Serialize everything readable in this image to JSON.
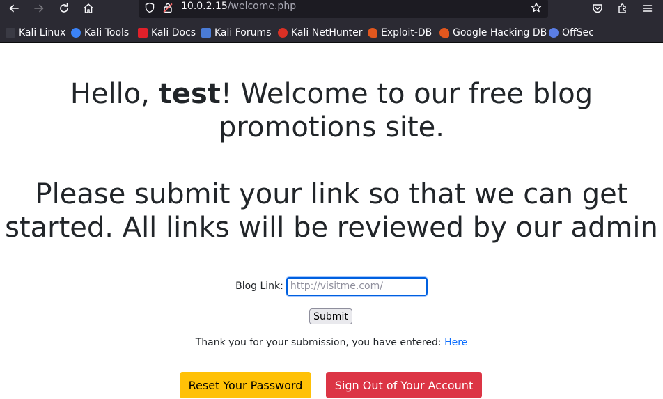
{
  "browser": {
    "url_host": "10.0.2.15",
    "url_path": "/welcome.php",
    "bookmarks": [
      {
        "label": "Kali Linux",
        "icon": "kali-dragon-icon",
        "color": "#4f4f4f"
      },
      {
        "label": "Kali Tools",
        "icon": "kali-tools-icon",
        "color": "#3b82f6"
      },
      {
        "label": "Kali Docs",
        "icon": "kali-docs-icon",
        "color": "#e0202a"
      },
      {
        "label": "Kali Forums",
        "icon": "kali-forums-icon",
        "color": "#4a7bd6"
      },
      {
        "label": "Kali NetHunter",
        "icon": "nethunter-icon",
        "color": "#d93025"
      },
      {
        "label": "Exploit-DB",
        "icon": "exploit-db-icon",
        "color": "#e2571e"
      },
      {
        "label": "Google Hacking DB",
        "icon": "ghdb-icon",
        "color": "#e2571e"
      },
      {
        "label": "OffSec",
        "icon": "offsec-icon",
        "color": "#5b7ee5"
      }
    ]
  },
  "page": {
    "greeting_prefix": "Hello, ",
    "username": "test",
    "greeting_suffix": "! Welcome to our free blog promotions site.",
    "submit_heading": "Please submit your link so that we can get started. All links will be reviewed by our admin",
    "form": {
      "label": "Blog Link:",
      "placeholder": "http://visitme.com/",
      "value": "",
      "submit_label": "Submit"
    },
    "thanks_text": "Thank you for your submission, you have entered: ",
    "thanks_link": "Here",
    "reset_button": "Reset Your Password",
    "signout_button": "Sign Out of Your Account"
  },
  "colors": {
    "link": "#0d6efd",
    "warning": "#ffc107",
    "danger": "#dc3545",
    "chrome": "#2b2a33"
  }
}
